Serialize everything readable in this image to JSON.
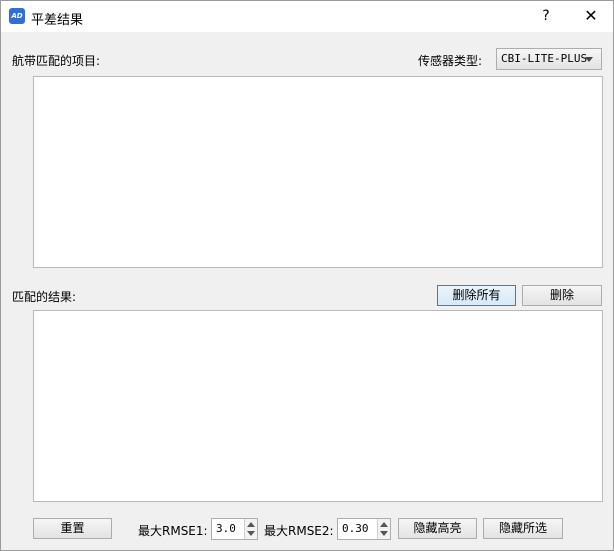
{
  "window": {
    "title": "平差结果",
    "app_icon_text": "AD",
    "help": "?",
    "close": "✕"
  },
  "top_section": {
    "label": "航带匹配的项目:",
    "sensor_label": "传感器类型:",
    "sensor_value": "CBI-LITE-PLUS"
  },
  "result_section": {
    "label": "匹配的结果:",
    "delete_all_label": "删除所有",
    "delete_label": "删除"
  },
  "bottom": {
    "reset_label": "重置",
    "rmse1_label": "最大RMSE1:",
    "rmse1_value": "3.0",
    "rmse2_label": "最大RMSE2:",
    "rmse2_value": "0.30",
    "hide_highlight_label": "隐藏高亮",
    "hide_selected_label": "隐藏所选"
  }
}
